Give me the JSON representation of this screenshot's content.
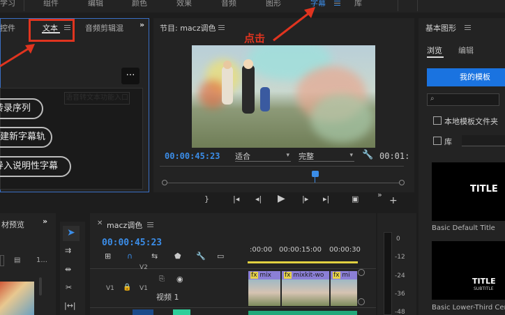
{
  "workspaces": [
    "学习",
    "组件",
    "编辑",
    "颜色",
    "效果",
    "音频",
    "图形",
    "字幕",
    "库"
  ],
  "active_workspace": "字幕",
  "left_panel": {
    "tabs": [
      "控件",
      "文本",
      "音频剪辑混"
    ],
    "active_tab": "文本",
    "more_label": "…",
    "hint_text": "语音转文本功能入口",
    "buttons": [
      "转录序列",
      "创建新字幕轨",
      "导入说明性字幕"
    ]
  },
  "annotation": {
    "label": "点击"
  },
  "program_monitor": {
    "title": "节目: macz调色",
    "timecode": "00:00:45:23",
    "fit": "适合",
    "quality": "完整",
    "end_timecode": "00:01:"
  },
  "essential_graphics": {
    "title": "基本图形",
    "tabs": [
      "浏览",
      "编辑"
    ],
    "active_tab": "浏览",
    "my_templates": "我的模板",
    "local_templates": "本地模板文件夹",
    "library": "库",
    "templates": [
      {
        "name": "Basic Default Title",
        "title_text": "TITLE",
        "sub_text": ""
      },
      {
        "name": "Basic Lower-Third Cent",
        "title_text": "TITLE",
        "sub_text": "SUBTITLE"
      }
    ]
  },
  "project_panel": {
    "title": "材预览",
    "count_label": "1..."
  },
  "timeline": {
    "title": "macz调色",
    "timecode": "00:00:45:23",
    "ruler": [
      ":00:00",
      "00:00:15:00",
      "00:00:30"
    ],
    "tracks": {
      "v2": "V2",
      "v1_src": "V1",
      "v1": "V1",
      "v1_name": "视频 1"
    },
    "clips": [
      "mix",
      "mixkit-wo",
      "mi"
    ],
    "fx": "fx"
  },
  "meter": {
    "labels": [
      "0",
      "-12",
      "-24",
      "-36",
      "-48"
    ]
  },
  "colors": {
    "accent": "#3b8de8",
    "annotation_red": "#e0341f",
    "clip_purple": "#8b7fd6",
    "my_templates_bg": "#1a73e0"
  }
}
